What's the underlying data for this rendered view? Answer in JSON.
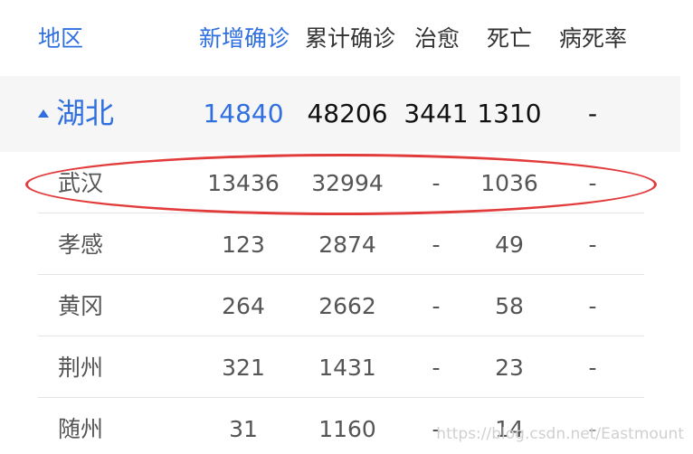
{
  "header": {
    "region": "地区",
    "new_confirmed": "新增确诊",
    "total_confirmed": "累计确诊",
    "cured": "治愈",
    "deaths": "死亡",
    "fatality_rate": "病死率"
  },
  "province": {
    "name": "湖北",
    "new_confirmed": "14840",
    "total_confirmed": "48206",
    "cured": "3441",
    "deaths": "1310",
    "fatality_rate": "-"
  },
  "cities": [
    {
      "name": "武汉",
      "new_confirmed": "13436",
      "total_confirmed": "32994",
      "cured": "-",
      "deaths": "1036",
      "fatality_rate": "-"
    },
    {
      "name": "孝感",
      "new_confirmed": "123",
      "total_confirmed": "2874",
      "cured": "-",
      "deaths": "49",
      "fatality_rate": "-"
    },
    {
      "name": "黄冈",
      "new_confirmed": "264",
      "total_confirmed": "2662",
      "cured": "-",
      "deaths": "58",
      "fatality_rate": "-"
    },
    {
      "name": "荆州",
      "new_confirmed": "321",
      "total_confirmed": "1431",
      "cured": "-",
      "deaths": "23",
      "fatality_rate": "-"
    },
    {
      "name": "随州",
      "new_confirmed": "31",
      "total_confirmed": "1160",
      "cured": "-",
      "deaths": "14",
      "fatality_rate": "-"
    }
  ],
  "watermark": "https://blog.csdn.net/Eastmount",
  "colors": {
    "accent": "#2f6fe0",
    "highlight_ellipse": "#e23b3b"
  }
}
